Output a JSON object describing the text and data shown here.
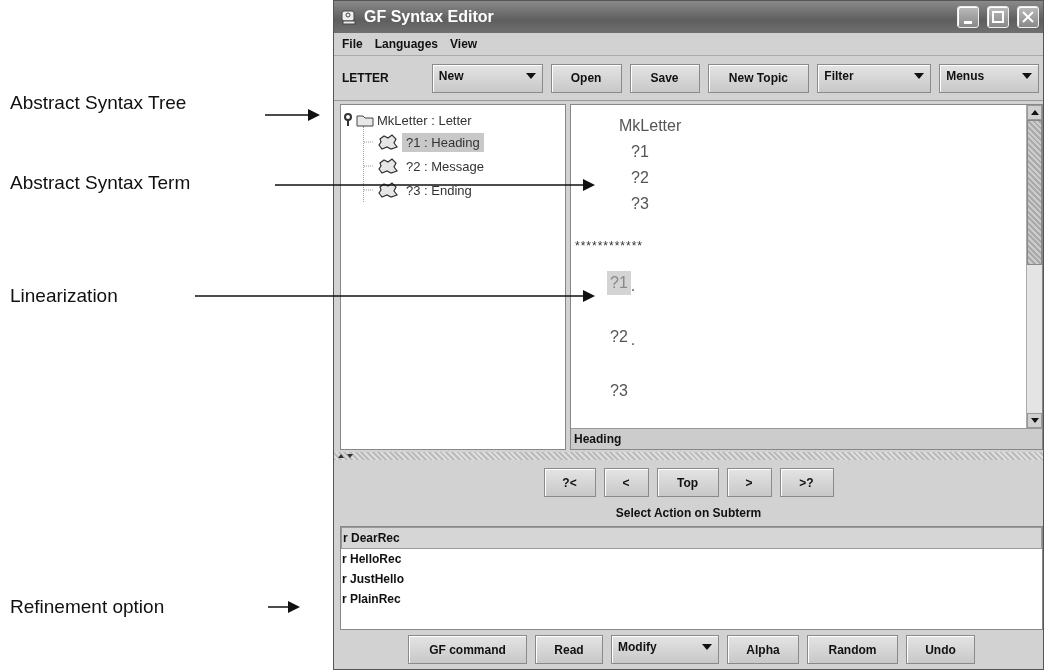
{
  "annotations": [
    {
      "label": "Abstract Syntax Tree"
    },
    {
      "label": "Abstract Syntax Term"
    },
    {
      "label": "Linearization"
    },
    {
      "label": "Refinement option"
    }
  ],
  "window": {
    "title": "GF Syntax Editor"
  },
  "menu": [
    "File",
    "Languages",
    "View"
  ],
  "toolbar": {
    "label": "LETTER",
    "items": [
      {
        "kind": "dropdown",
        "label": "New"
      },
      {
        "kind": "button",
        "label": "Open"
      },
      {
        "kind": "button",
        "label": "Save"
      },
      {
        "kind": "button",
        "label": "New Topic"
      },
      {
        "kind": "dropdown",
        "label": "Filter"
      },
      {
        "kind": "dropdown",
        "label": "Menus"
      }
    ]
  },
  "tree": {
    "label": "MkLetter : Letter",
    "expanded": true,
    "children": [
      {
        "label": "?1 : Heading",
        "selected": true
      },
      {
        "label": "?2 : Message",
        "selected": false
      },
      {
        "label": "?3 : Ending",
        "selected": false
      }
    ]
  },
  "term": {
    "text": "MkLetter",
    "children": [
      {
        "text": "?1"
      },
      {
        "text": "?2"
      },
      {
        "text": "?3"
      }
    ]
  },
  "separator": "************",
  "linearization": [
    {
      "text": "?1",
      "punct": ".",
      "selected": true
    },
    {
      "text": "?2",
      "punct": ".",
      "selected": false
    },
    {
      "text": "?3",
      "selected": false
    }
  ],
  "status": "Heading",
  "nav_buttons": [
    "?<",
    "<",
    "Top",
    ">",
    ">?"
  ],
  "action_label": "Select Action on Subterm",
  "refinements": [
    {
      "label": "r DearRec",
      "selected": true
    },
    {
      "label": "r HelloRec",
      "selected": false
    },
    {
      "label": "r JustHello",
      "selected": false
    },
    {
      "label": "r PlainRec",
      "selected": false
    }
  ],
  "bottom_buttons": [
    {
      "kind": "button",
      "label": "GF command"
    },
    {
      "kind": "button",
      "label": "Read"
    },
    {
      "kind": "dropdown",
      "label": "Modify"
    },
    {
      "kind": "button",
      "label": "Alpha"
    },
    {
      "kind": "button",
      "label": "Random"
    },
    {
      "kind": "button",
      "label": "Undo"
    }
  ]
}
